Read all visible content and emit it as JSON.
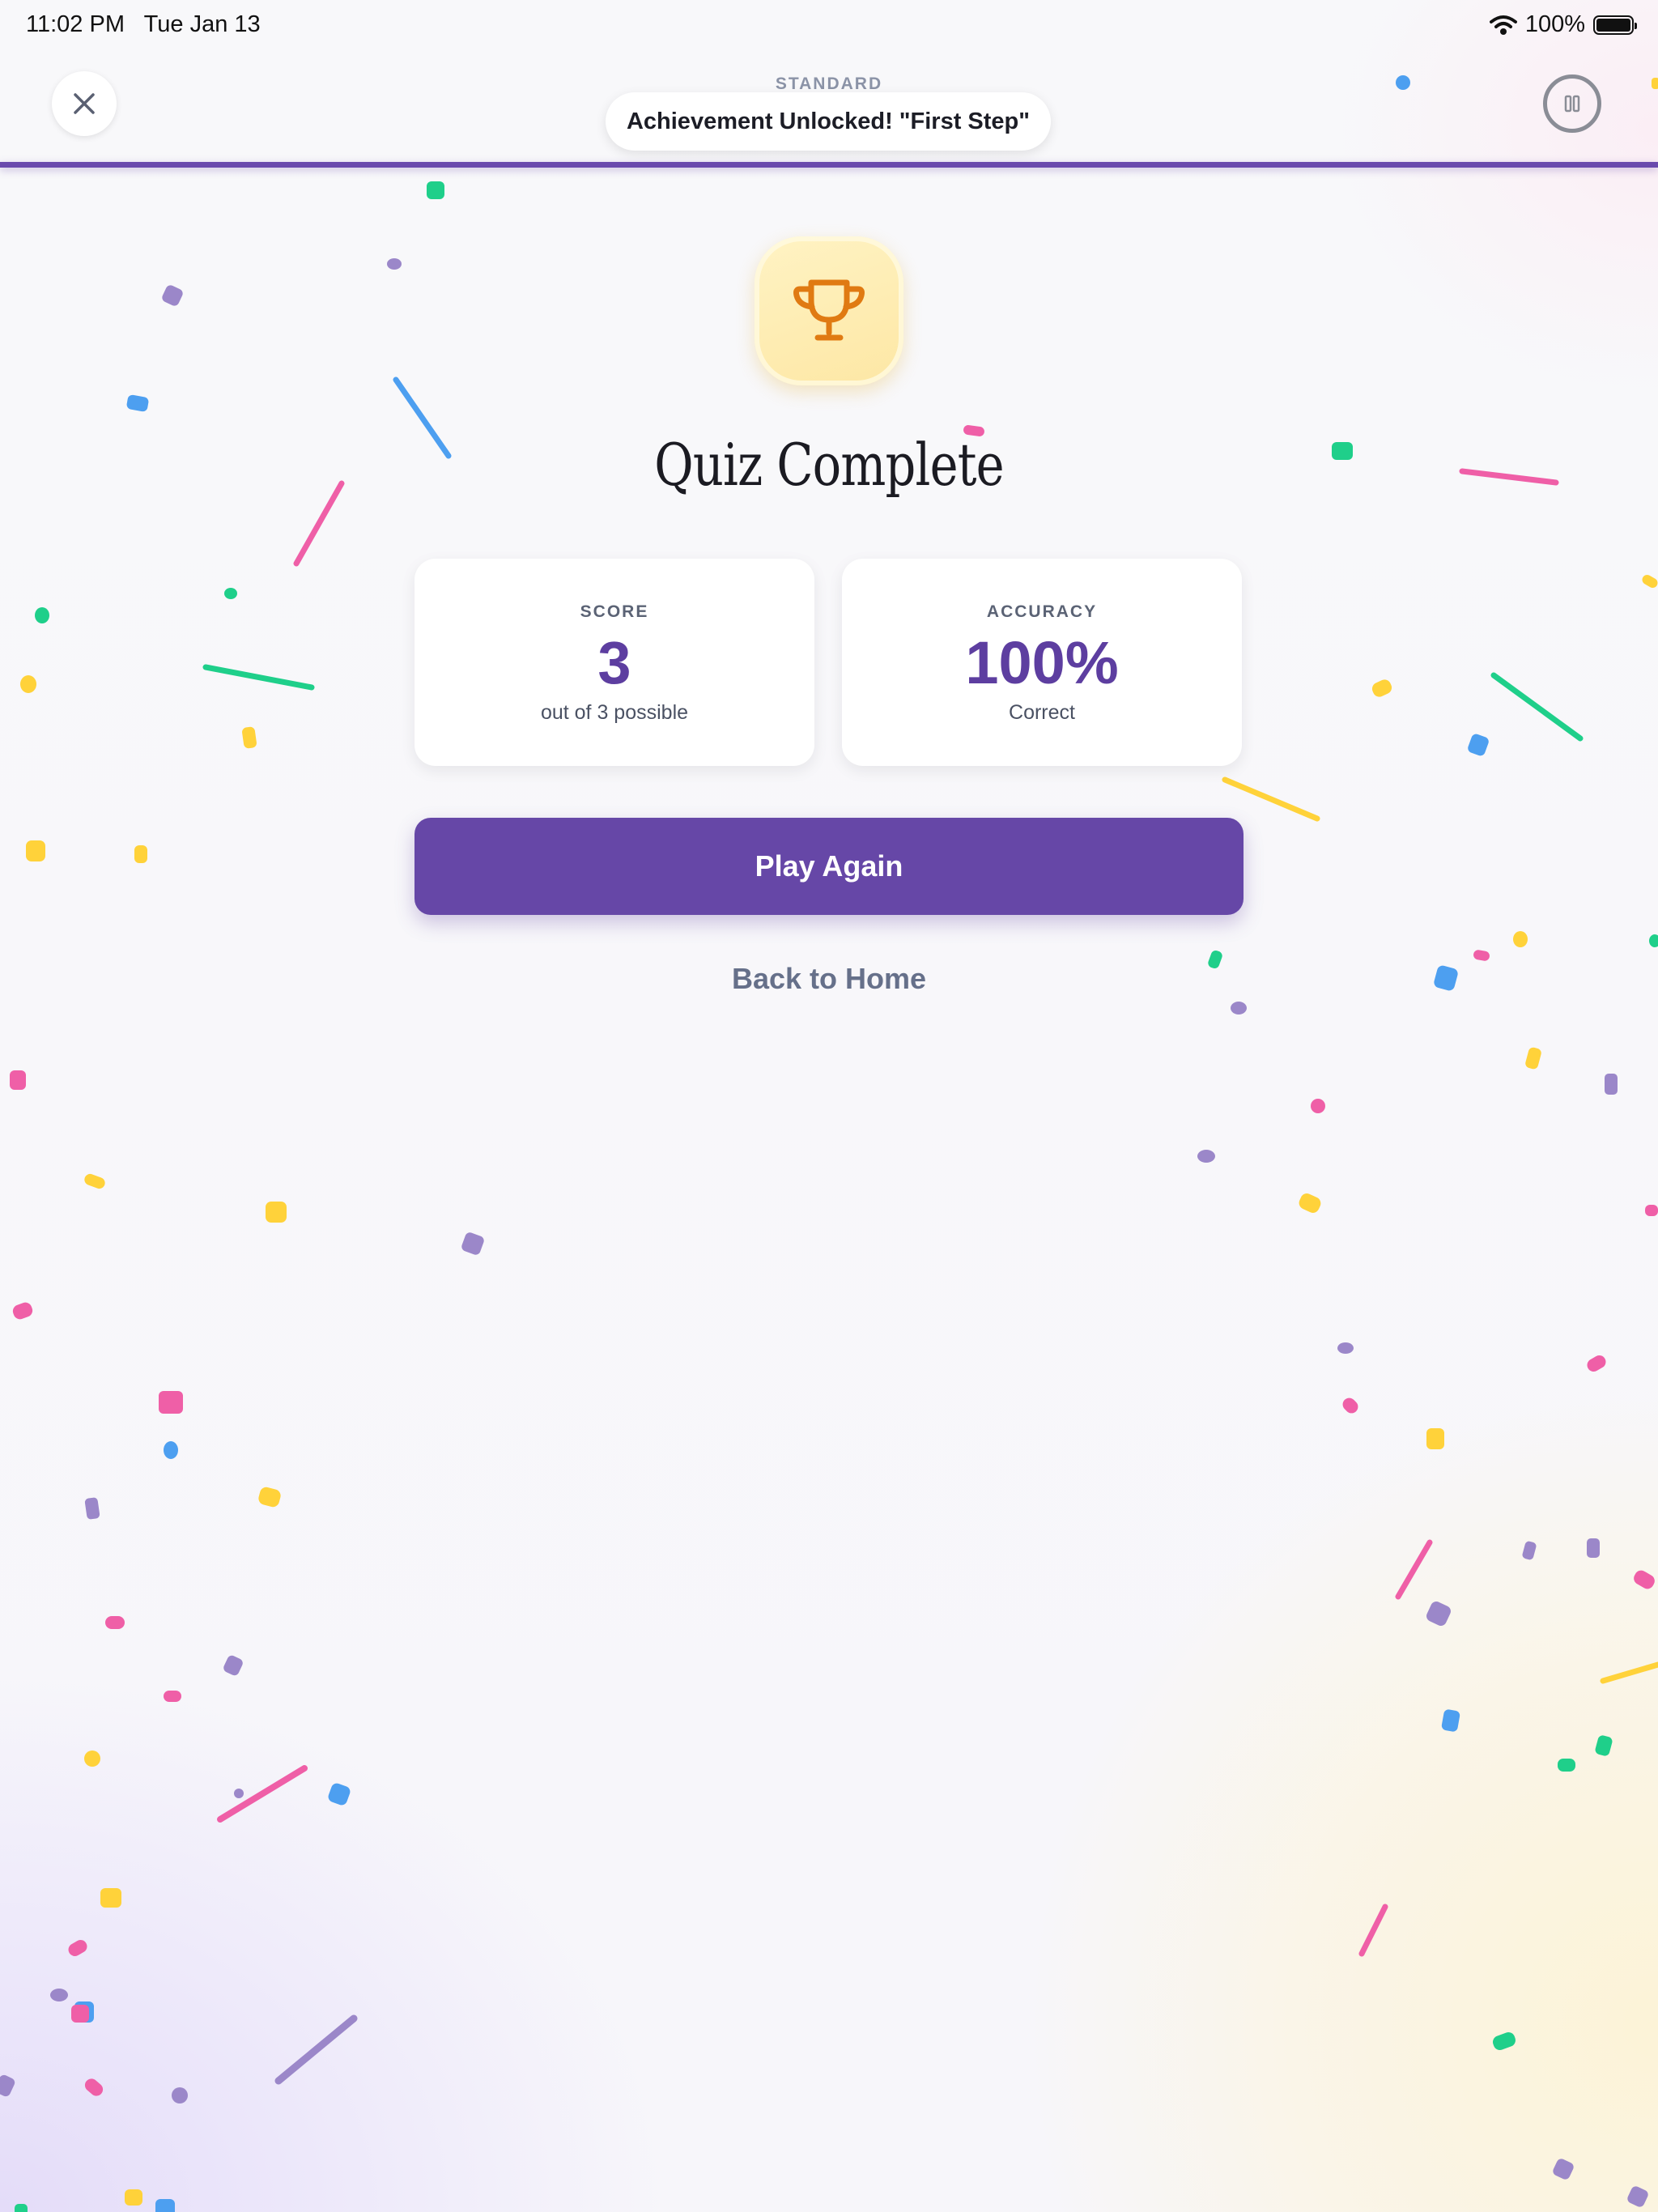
{
  "status_bar": {
    "time": "11:02 PM",
    "date": "Tue Jan 13",
    "battery": "100%",
    "icons": [
      "wifi-icon",
      "battery-icon"
    ]
  },
  "header": {
    "mode_label": "STANDARD",
    "toast": "Achievement Unlocked! \"First Step\"",
    "close_icon": "close-icon",
    "pause_icon": "pause-icon",
    "progress": 1.0
  },
  "result": {
    "icon": "trophy-icon",
    "title": "Quiz Complete",
    "score": {
      "label": "SCORE",
      "value": "3",
      "sub": "out of 3 possible"
    },
    "accuracy": {
      "label": "ACCURACY",
      "value": "100%",
      "sub": "Correct"
    }
  },
  "actions": {
    "play_again": "Play Again",
    "back_home": "Back to Home"
  },
  "colors": {
    "primary": "#6647a7",
    "trophy": "#e07a12",
    "confetti": [
      "#9b87c9",
      "#4d9ff0",
      "#ef5fa7",
      "#1fcf8a",
      "#ffd23a"
    ]
  }
}
